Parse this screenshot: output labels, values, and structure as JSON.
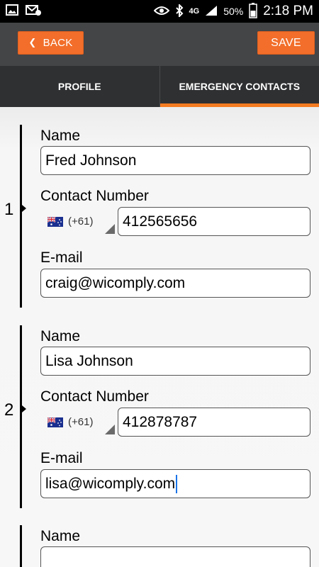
{
  "status_bar": {
    "time": "2:18 PM",
    "battery": "50%",
    "network": "4G",
    "icons": [
      "image-icon",
      "email-icon",
      "eye-icon",
      "bluetooth-icon",
      "signal-icon",
      "battery-icon"
    ]
  },
  "toolbar": {
    "back_label": "BACK",
    "save_label": "SAVE"
  },
  "tabs": [
    {
      "label": "PROFILE",
      "active": false
    },
    {
      "label": "EMERGENCY CONTACTS",
      "active": true
    }
  ],
  "labels": {
    "name": "Name",
    "contact_number": "Contact Number",
    "email": "E-mail"
  },
  "contacts": [
    {
      "index": "1",
      "name": "Fred Johnson",
      "country_code": "(+61)",
      "phone": "412565656",
      "email": "craig@wicomply.com"
    },
    {
      "index": "2",
      "name": "Lisa Johnson",
      "country_code": "(+61)",
      "phone": "412878787",
      "email": "lisa@wicomply.com"
    },
    {
      "index": "",
      "name": "",
      "country_code": "",
      "phone": "",
      "email": ""
    }
  ],
  "colors": {
    "accent": "#f26e2a",
    "action_bar": "#444547",
    "tab_bar": "#2f3032",
    "cursor": "#1a73e8"
  }
}
